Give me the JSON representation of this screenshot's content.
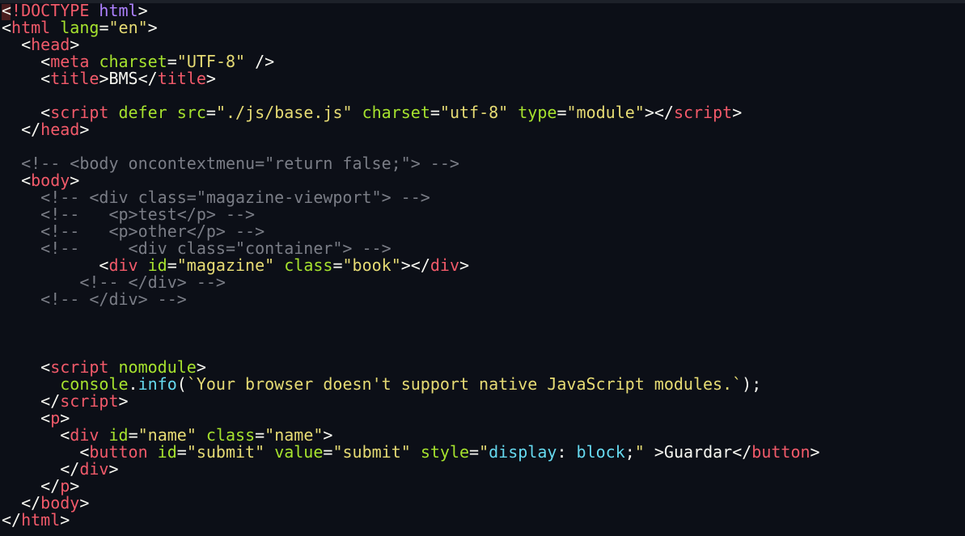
{
  "colors": {
    "background": "#0c0f17",
    "text": "#f8f8f2",
    "tag": "#f25a6a",
    "attribute": "#a6e22e",
    "string": "#e6db74",
    "comment": "#7a7d86",
    "keyword": "#ae81ff",
    "function": "#66d9ef"
  },
  "editor": {
    "lines": [
      [
        {
          "t": "text",
          "v": "<"
        },
        {
          "t": "tag",
          "v": "!DOCTYPE"
        },
        {
          "t": "text",
          "v": " "
        },
        {
          "t": "keyword",
          "v": "html"
        },
        {
          "t": "text",
          "v": ">"
        }
      ],
      [
        {
          "t": "text",
          "v": "<"
        },
        {
          "t": "tag",
          "v": "html"
        },
        {
          "t": "text",
          "v": " "
        },
        {
          "t": "attribute",
          "v": "lang"
        },
        {
          "t": "text",
          "v": "="
        },
        {
          "t": "string",
          "v": "\"en\""
        },
        {
          "t": "text",
          "v": ">"
        }
      ],
      [
        {
          "t": "text",
          "v": "  <"
        },
        {
          "t": "tag",
          "v": "head"
        },
        {
          "t": "text",
          "v": ">"
        }
      ],
      [
        {
          "t": "text",
          "v": "    <"
        },
        {
          "t": "tag",
          "v": "meta"
        },
        {
          "t": "text",
          "v": " "
        },
        {
          "t": "attribute",
          "v": "charset"
        },
        {
          "t": "text",
          "v": "="
        },
        {
          "t": "string",
          "v": "\"UTF-8\""
        },
        {
          "t": "text",
          "v": " />"
        }
      ],
      [
        {
          "t": "text",
          "v": "    <"
        },
        {
          "t": "tag",
          "v": "title"
        },
        {
          "t": "text",
          "v": ">BMS</"
        },
        {
          "t": "tag",
          "v": "title"
        },
        {
          "t": "text",
          "v": ">"
        }
      ],
      [],
      [
        {
          "t": "text",
          "v": "    <"
        },
        {
          "t": "tag",
          "v": "script"
        },
        {
          "t": "text",
          "v": " "
        },
        {
          "t": "attribute",
          "v": "defer"
        },
        {
          "t": "text",
          "v": " "
        },
        {
          "t": "attribute",
          "v": "src"
        },
        {
          "t": "text",
          "v": "="
        },
        {
          "t": "string",
          "v": "\"./js/base.js\""
        },
        {
          "t": "text",
          "v": " "
        },
        {
          "t": "attribute",
          "v": "charset"
        },
        {
          "t": "text",
          "v": "="
        },
        {
          "t": "string",
          "v": "\"utf-8\""
        },
        {
          "t": "text",
          "v": " "
        },
        {
          "t": "attribute",
          "v": "type"
        },
        {
          "t": "text",
          "v": "="
        },
        {
          "t": "string",
          "v": "\"module\""
        },
        {
          "t": "text",
          "v": "></"
        },
        {
          "t": "tag",
          "v": "script"
        },
        {
          "t": "text",
          "v": ">"
        }
      ],
      [
        {
          "t": "text",
          "v": "  </"
        },
        {
          "t": "tag",
          "v": "head"
        },
        {
          "t": "text",
          "v": ">"
        }
      ],
      [],
      [
        {
          "t": "comment",
          "v": "  <!-- <body oncontextmenu=\"return false;\"> -->"
        }
      ],
      [
        {
          "t": "text",
          "v": "  <"
        },
        {
          "t": "tag",
          "v": "body"
        },
        {
          "t": "text",
          "v": ">"
        }
      ],
      [
        {
          "t": "comment",
          "v": "    <!-- <div class=\"magazine-viewport\"> -->"
        }
      ],
      [
        {
          "t": "comment",
          "v": "    <!--   <p>test</p> -->"
        }
      ],
      [
        {
          "t": "comment",
          "v": "    <!--   <p>other</p> -->"
        }
      ],
      [
        {
          "t": "comment",
          "v": "    <!--     <div class=\"container\"> -->"
        }
      ],
      [
        {
          "t": "text",
          "v": "          <"
        },
        {
          "t": "tag",
          "v": "div"
        },
        {
          "t": "text",
          "v": " "
        },
        {
          "t": "attribute",
          "v": "id"
        },
        {
          "t": "text",
          "v": "="
        },
        {
          "t": "string",
          "v": "\"magazine\""
        },
        {
          "t": "text",
          "v": " "
        },
        {
          "t": "attribute",
          "v": "class"
        },
        {
          "t": "text",
          "v": "="
        },
        {
          "t": "string",
          "v": "\"book\""
        },
        {
          "t": "text",
          "v": "></"
        },
        {
          "t": "tag",
          "v": "div"
        },
        {
          "t": "text",
          "v": ">"
        }
      ],
      [
        {
          "t": "comment",
          "v": "        <!-- </div> -->"
        }
      ],
      [
        {
          "t": "comment",
          "v": "    <!-- </div> -->"
        }
      ],
      [],
      [],
      [],
      [
        {
          "t": "text",
          "v": "    <"
        },
        {
          "t": "tag",
          "v": "script"
        },
        {
          "t": "text",
          "v": " "
        },
        {
          "t": "attribute",
          "v": "nomodule"
        },
        {
          "t": "text",
          "v": ">"
        }
      ],
      [
        {
          "t": "text",
          "v": "      "
        },
        {
          "t": "attribute",
          "v": "console"
        },
        {
          "t": "text",
          "v": "."
        },
        {
          "t": "function",
          "v": "info"
        },
        {
          "t": "text",
          "v": "("
        },
        {
          "t": "string",
          "v": "`Your browser doesn't support native JavaScript modules.`"
        },
        {
          "t": "text",
          "v": ");"
        }
      ],
      [
        {
          "t": "text",
          "v": "    </"
        },
        {
          "t": "tag",
          "v": "script"
        },
        {
          "t": "text",
          "v": ">"
        }
      ],
      [
        {
          "t": "text",
          "v": "    <"
        },
        {
          "t": "tag",
          "v": "p"
        },
        {
          "t": "text",
          "v": ">"
        }
      ],
      [
        {
          "t": "text",
          "v": "      <"
        },
        {
          "t": "tag",
          "v": "div"
        },
        {
          "t": "text",
          "v": " "
        },
        {
          "t": "attribute",
          "v": "id"
        },
        {
          "t": "text",
          "v": "="
        },
        {
          "t": "string",
          "v": "\"name\""
        },
        {
          "t": "text",
          "v": " "
        },
        {
          "t": "attribute",
          "v": "class"
        },
        {
          "t": "text",
          "v": "="
        },
        {
          "t": "string",
          "v": "\"name\""
        },
        {
          "t": "text",
          "v": ">"
        }
      ],
      [
        {
          "t": "text",
          "v": "        <"
        },
        {
          "t": "tag",
          "v": "button"
        },
        {
          "t": "text",
          "v": " "
        },
        {
          "t": "attribute",
          "v": "id"
        },
        {
          "t": "text",
          "v": "="
        },
        {
          "t": "string",
          "v": "\"submit\""
        },
        {
          "t": "text",
          "v": " "
        },
        {
          "t": "attribute",
          "v": "value"
        },
        {
          "t": "text",
          "v": "="
        },
        {
          "t": "string",
          "v": "\"submit\""
        },
        {
          "t": "text",
          "v": " "
        },
        {
          "t": "attribute",
          "v": "style"
        },
        {
          "t": "text",
          "v": "="
        },
        {
          "t": "string",
          "v": "\""
        },
        {
          "t": "function",
          "v": "display"
        },
        {
          "t": "text",
          "v": ": "
        },
        {
          "t": "function",
          "v": "block"
        },
        {
          "t": "text",
          "v": ";"
        },
        {
          "t": "string",
          "v": "\""
        },
        {
          "t": "text",
          "v": " >Guardar</"
        },
        {
          "t": "tag",
          "v": "button"
        },
        {
          "t": "text",
          "v": ">"
        }
      ],
      [
        {
          "t": "text",
          "v": "      </"
        },
        {
          "t": "tag",
          "v": "div"
        },
        {
          "t": "text",
          "v": ">"
        }
      ],
      [
        {
          "t": "text",
          "v": "    </"
        },
        {
          "t": "tag",
          "v": "p"
        },
        {
          "t": "text",
          "v": ">"
        }
      ],
      [
        {
          "t": "text",
          "v": "  </"
        },
        {
          "t": "tag",
          "v": "body"
        },
        {
          "t": "text",
          "v": ">"
        }
      ],
      [
        {
          "t": "text",
          "v": "</"
        },
        {
          "t": "tag",
          "v": "html"
        },
        {
          "t": "text",
          "v": ">"
        }
      ]
    ]
  }
}
